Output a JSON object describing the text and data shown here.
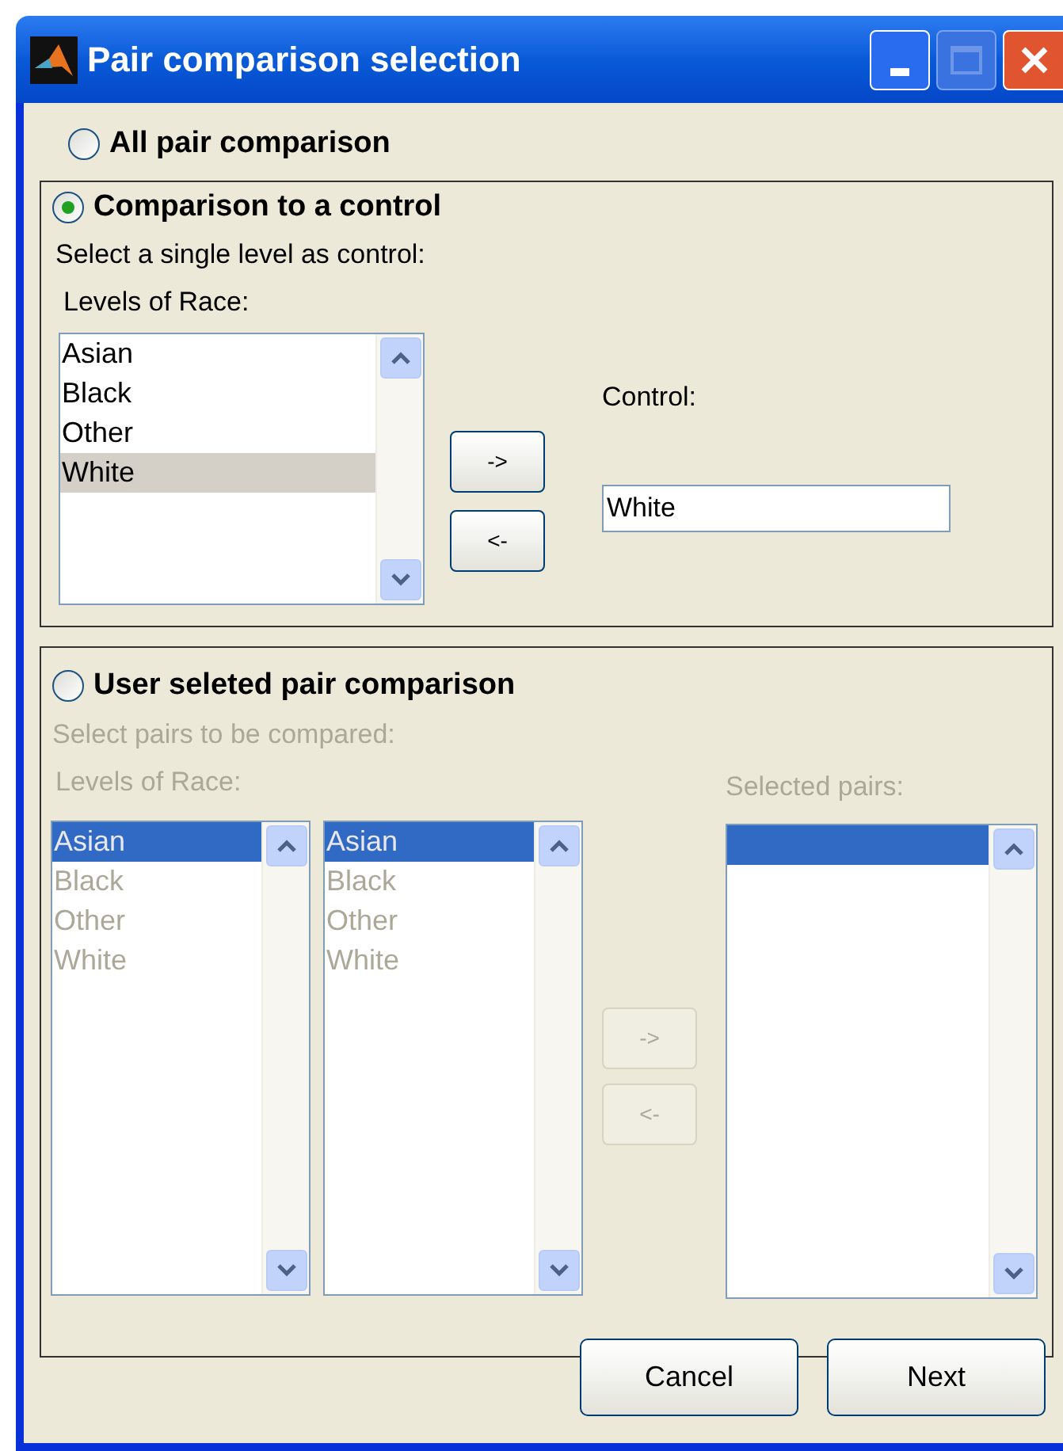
{
  "window": {
    "title": "Pair comparison selection"
  },
  "all_pair": {
    "label": "All pair comparison",
    "selected": false
  },
  "control_section": {
    "label": "Comparison to a control",
    "selected": true,
    "disabled": false,
    "instruction": "Select a single level as control:",
    "list_label": "Levels of Race:",
    "levels": [
      {
        "label": "Asian",
        "selected": false
      },
      {
        "label": "Black",
        "selected": false
      },
      {
        "label": "Other",
        "selected": false
      },
      {
        "label": "White",
        "selected": true
      }
    ],
    "buttons": [
      {
        "label": "->"
      },
      {
        "label": "<-"
      }
    ],
    "control_label": "Control:",
    "control_value": "White"
  },
  "pair_section": {
    "label": "User seleted pair comparison",
    "selected": false,
    "disabled": true,
    "instruction": "Select pairs to be compared:",
    "list_label": "Levels of Race:",
    "list_a": [
      {
        "label": "Asian",
        "selected": true
      },
      {
        "label": "Black",
        "selected": false
      },
      {
        "label": "Other",
        "selected": false
      },
      {
        "label": "White",
        "selected": false
      }
    ],
    "list_b": [
      {
        "label": "Asian",
        "selected": true
      },
      {
        "label": "Black",
        "selected": false
      },
      {
        "label": "Other",
        "selected": false
      },
      {
        "label": "White",
        "selected": false
      }
    ],
    "buttons": [
      {
        "label": "->"
      },
      {
        "label": "<-"
      }
    ],
    "selected_pairs_label": "Selected pairs:",
    "selected_pairs_first_row_highlighted": true
  },
  "buttons": [
    {
      "label": "Cancel"
    },
    {
      "label": "Next"
    }
  ]
}
